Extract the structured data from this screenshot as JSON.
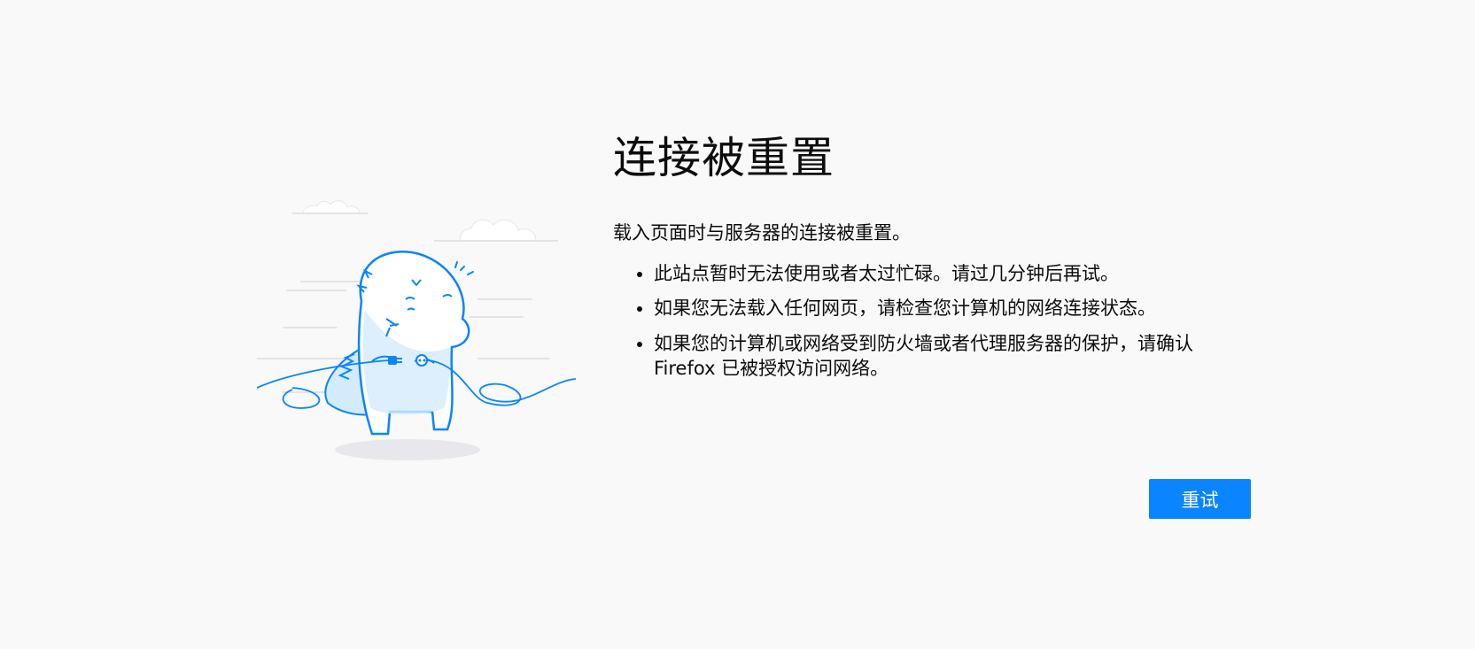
{
  "error": {
    "title": "连接被重置",
    "intro": "载入页面时与服务器的连接被重置。",
    "reasons": [
      "此站点暂时无法使用或者太过忙碌。请过几分钟后再试。",
      "如果您无法载入任何网页，请检查您计算机的网络连接状态。",
      "如果您的计算机或网络受到防火墙或者代理服务器的保护，请确认 Firefox 已被授权访问网络。"
    ],
    "retry_label": "重试"
  },
  "colors": {
    "background": "#f9f9fa",
    "accent": "#0a84ff",
    "illustration_stroke": "#0a84ff",
    "illustration_fill": "#d4ebfb"
  },
  "icons": {
    "illustration": "disconnected-dino-illustration"
  }
}
